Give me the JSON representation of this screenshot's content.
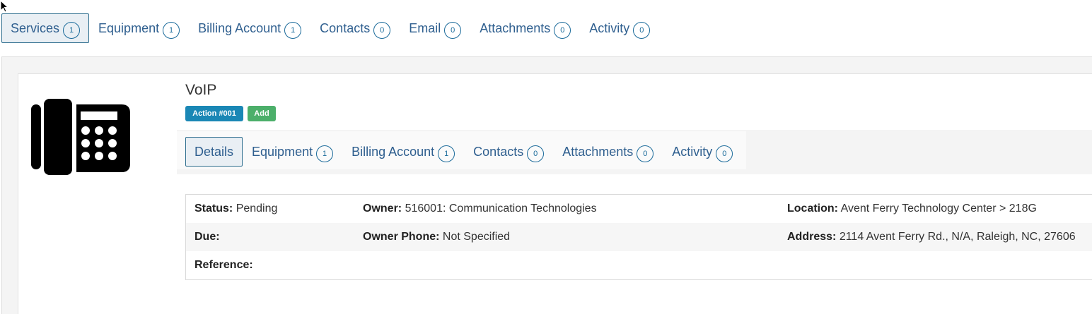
{
  "top_tabs": [
    {
      "label": "Services",
      "count": "1"
    },
    {
      "label": "Equipment",
      "count": "1"
    },
    {
      "label": "Billing Account",
      "count": "1"
    },
    {
      "label": "Contacts",
      "count": "0"
    },
    {
      "label": "Email",
      "count": "0"
    },
    {
      "label": "Attachments",
      "count": "0"
    },
    {
      "label": "Activity",
      "count": "0"
    }
  ],
  "service": {
    "title": "VoIP",
    "icon": "desk-phone-icon",
    "action_label": "Action #001",
    "add_label": "Add"
  },
  "sub_tabs": [
    {
      "label": "Details",
      "count": ""
    },
    {
      "label": "Equipment",
      "count": "1"
    },
    {
      "label": "Billing Account",
      "count": "1"
    },
    {
      "label": "Contacts",
      "count": "0"
    },
    {
      "label": "Attachments",
      "count": "0"
    },
    {
      "label": "Activity",
      "count": "0"
    }
  ],
  "details": {
    "status_label": "Status:",
    "status_value": "Pending",
    "owner_label": "Owner:",
    "owner_value": "516001: Communication Technologies",
    "location_label": "Location:",
    "location_value": "Avent Ferry Technology Center > 218G",
    "due_label": "Due:",
    "due_value": "",
    "owner_phone_label": "Owner Phone:",
    "owner_phone_value": "Not Specified",
    "address_label": "Address:",
    "address_value": "2114 Avent Ferry Rd., N/A, Raleigh, NC, 27606",
    "reference_label": "Reference:",
    "reference_value": ""
  },
  "colors": {
    "link": "#2f5f8f",
    "badge": "#1a6a9a",
    "action_button": "#1a87b5",
    "add_button": "#4caf6a"
  }
}
